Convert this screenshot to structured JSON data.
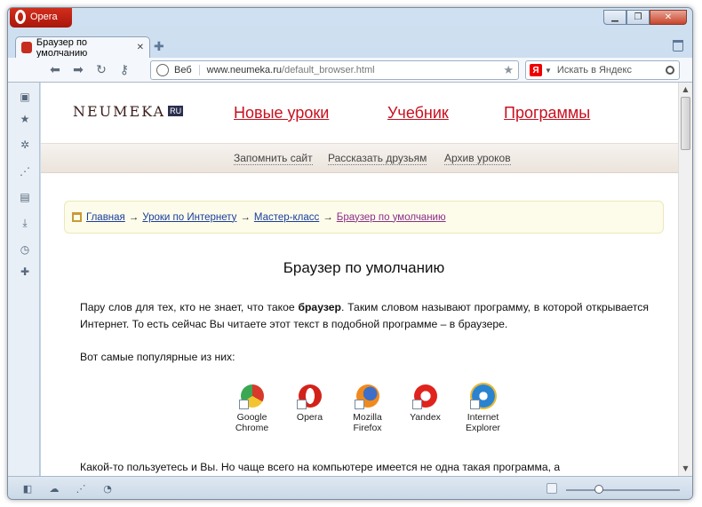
{
  "window": {
    "title": "Opera",
    "controls": {
      "minimize": "▁",
      "maximize": "❐",
      "close": "✕"
    }
  },
  "tabs": [
    {
      "label": "Браузер по умолчанию",
      "close": "✕"
    }
  ],
  "toolbar": {
    "address": {
      "prefix": "Веб",
      "domain": "www.neumeka.ru",
      "path": "/default_browser.html"
    },
    "search": {
      "engine": "Я",
      "placeholder": "Искать в Яндекс"
    }
  },
  "site": {
    "logo": "Neumeka",
    "logo_badge": "RU",
    "nav": [
      "Новые уроки",
      "Учебник",
      "Программы"
    ],
    "subnav": [
      "Запомнить сайт",
      "Рассказать друзьям",
      "Архив уроков"
    ]
  },
  "breadcrumbs": [
    {
      "label": "Главная"
    },
    {
      "label": "Уроки по Интернету"
    },
    {
      "label": "Мастер-класс"
    },
    {
      "label": "Браузер по умолчанию"
    }
  ],
  "breadcrumb_sep": "→",
  "article": {
    "title": "Браузер по умолчанию",
    "p1_before": "Пару слов для тех, кто не знает, что такое ",
    "p1_bold": "браузер",
    "p1_after": ". Таким словом называют программу, в которой открывается Интернет. То есть сейчас Вы читаете этот текст в подобной программе – в браузере.",
    "p2": "Вот самые популярные из них:",
    "p3": "Какой-то пользуетесь и Вы. Но чаще всего на компьютере имеется не одна такая программа, а"
  },
  "browsers": [
    {
      "line1": "Google",
      "line2": "Chrome",
      "icon": "chrome-icon"
    },
    {
      "line1": "Opera",
      "line2": "",
      "icon": "opera-icon"
    },
    {
      "line1": "Mozilla",
      "line2": "Firefox",
      "icon": "firefox-icon"
    },
    {
      "line1": "Yandex",
      "line2": "",
      "icon": "yandex-icon"
    },
    {
      "line1": "Internet",
      "line2": "Explorer",
      "icon": "ie-icon"
    }
  ],
  "colors": {
    "opera_red": "#c8101f",
    "link_blue": "#1a3d9e",
    "visited_purple": "#8a2f8a"
  }
}
